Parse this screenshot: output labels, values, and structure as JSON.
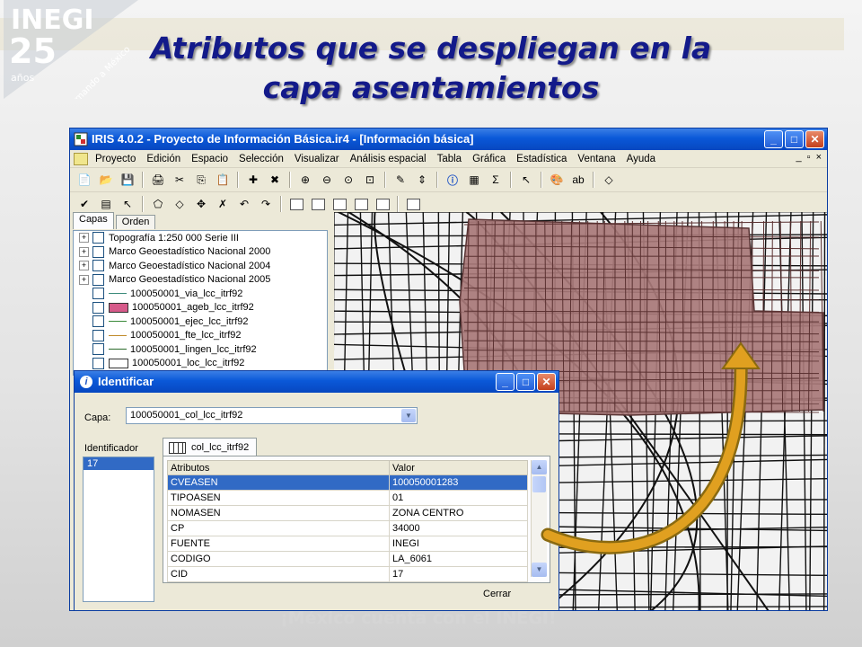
{
  "slide": {
    "title_line1": "Atributos que se despliegan en la",
    "title_line2": "capa asentamientos",
    "logo_text": "INEGI",
    "logo_years": "25",
    "logo_years_label": "años",
    "logo_tagline": "Informando a México",
    "footer_text": "¡México cuenta con el INEGI!"
  },
  "iris_window": {
    "title": "IRIS 4.0.2 - Proyecto de Información Básica.ir4 - [Información básica]",
    "menu": [
      "Proyecto",
      "Edición",
      "Espacio",
      "Selección",
      "Visualizar",
      "Análisis espacial",
      "Tabla",
      "Gráfica",
      "Estadística",
      "Ventana",
      "Ayuda"
    ],
    "mdi_controls": [
      "_",
      "▫",
      "×"
    ],
    "window_controls": {
      "minimize": "_",
      "maximize": "□",
      "close": "✕"
    }
  },
  "layers_panel": {
    "tabs": [
      "Capas",
      "Orden"
    ],
    "layers": [
      {
        "name": "Topografía 1:250 000 Serie III",
        "expandable": true
      },
      {
        "name": "Marco Geoestadístico Nacional 2000",
        "expandable": true
      },
      {
        "name": "Marco Geoestadístico Nacional 2004",
        "expandable": true
      },
      {
        "name": "Marco Geoestadístico Nacional 2005",
        "expandable": true
      },
      {
        "name": "100050001_via_lcc_itrf92",
        "symbol": "line",
        "color": "#3a8a7a"
      },
      {
        "name": "100050001_ageb_lcc_itrf92",
        "symbol": "fill",
        "color": "#d65a8a"
      },
      {
        "name": "100050001_ejec_lcc_itrf92",
        "symbol": "line",
        "color": "#3a8a3a"
      },
      {
        "name": "100050001_fte_lcc_itrf92",
        "symbol": "line",
        "color": "#c08a2a"
      },
      {
        "name": "100050001_lingen_lcc_itrf92",
        "symbol": "line",
        "color": "#2a6a2a"
      },
      {
        "name": "100050001_loc_lcc_itrf92",
        "symbol": "fill",
        "color": "#ffffff"
      }
    ]
  },
  "identify_dialog": {
    "title": "Identificar",
    "capa_label": "Capa:",
    "capa_value": "100050001_col_lcc_itrf92",
    "identificador_label": "Identificador",
    "identificadores": [
      "17"
    ],
    "table_tab": "col_lcc_itrf92",
    "columns": [
      "Atributos",
      "Valor"
    ],
    "rows": [
      {
        "attr": "CVEASEN",
        "value": "100050001283",
        "selected": true
      },
      {
        "attr": "TIPOASEN",
        "value": "01"
      },
      {
        "attr": "NOMASEN",
        "value": "ZONA CENTRO"
      },
      {
        "attr": "CP",
        "value": "34000"
      },
      {
        "attr": "FUENTE",
        "value": "INEGI"
      },
      {
        "attr": "CODIGO",
        "value": "LA_6061"
      },
      {
        "attr": "CID",
        "value": "17"
      }
    ],
    "close_label": "Cerrar"
  },
  "colors": {
    "title_text": "#131a8a",
    "selection": "#316ac5",
    "highlight_polygon": "#a87878",
    "arrow": "#e0a020"
  }
}
